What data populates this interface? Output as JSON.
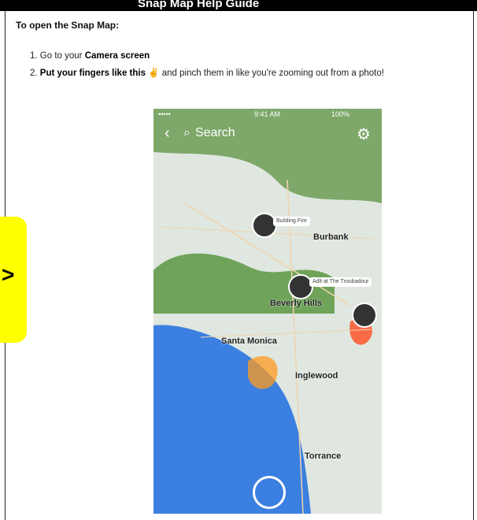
{
  "header": {
    "title": "Snap Map Help Guide"
  },
  "document": {
    "heading": "To open the Snap Map:",
    "steps": [
      {
        "number": "1.",
        "prefix": "Go to your ",
        "bold": "Camera screen",
        "suffix": ""
      },
      {
        "number": "2.",
        "prefix": "",
        "bold": "Put your fingers like this",
        "suffix": " and pinch them in like you're zooming out from a photo!"
      }
    ]
  },
  "side_note": {
    "text": ">"
  },
  "phone": {
    "status": {
      "signal": "••••• ",
      "time": "9:41 AM",
      "battery": "100%"
    },
    "search_placeholder": "Search",
    "places": [
      {
        "name": "Burbank"
      },
      {
        "name": "Beverly Hills"
      },
      {
        "name": "Santa Monica"
      },
      {
        "name": "Inglewood"
      },
      {
        "name": "Torrance"
      }
    ],
    "stories": [
      {
        "label": "Building Fire"
      },
      {
        "label": "Adlt at The Troubadour"
      }
    ]
  },
  "colors": {
    "water": "#3b7fe0",
    "land": "#dfe7e0",
    "green": "#6fa35a",
    "yellow_note": "#ffff00"
  }
}
